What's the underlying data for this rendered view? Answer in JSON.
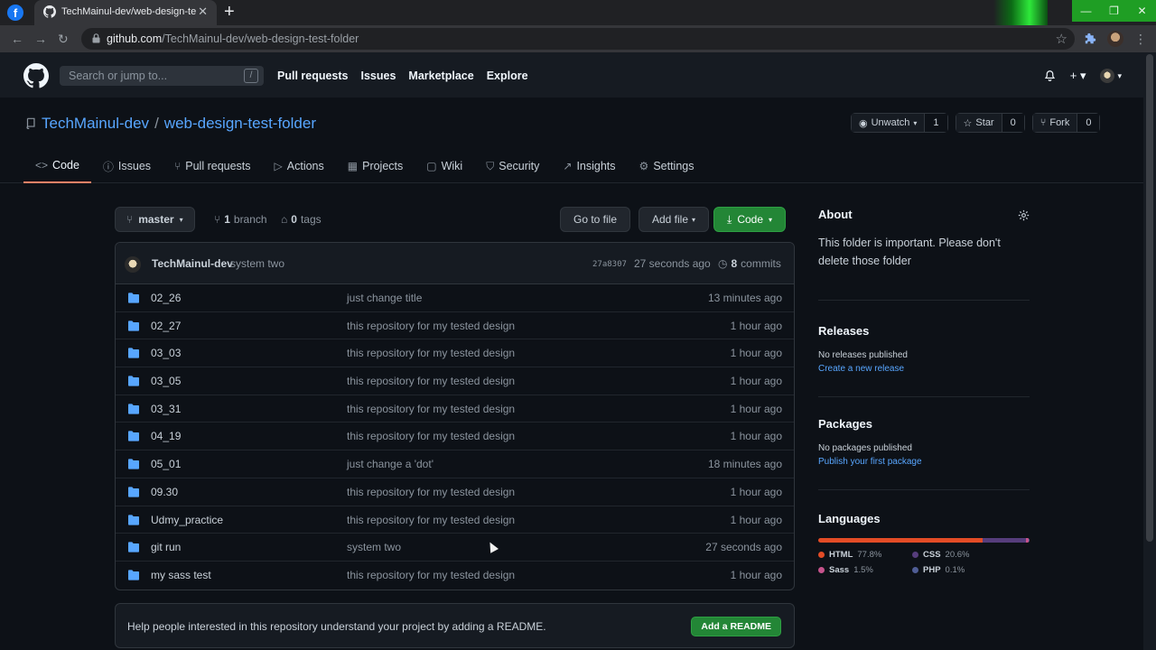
{
  "browser": {
    "tab_title": "TechMainul-dev/web-design-te...",
    "url_host": "github.com",
    "url_path": "/TechMainul-dev/web-design-test-folder",
    "accent_color": "#1f9e24"
  },
  "header": {
    "search_placeholder": "Search or jump to...",
    "search_shortcut": "/",
    "nav": [
      "Pull requests",
      "Issues",
      "Marketplace",
      "Explore"
    ]
  },
  "repo": {
    "owner": "TechMainul-dev",
    "separator": "/",
    "name": "web-design-test-folder",
    "watch_label": "Unwatch",
    "watch_count": "1",
    "star_label": "Star",
    "star_count": "0",
    "fork_label": "Fork",
    "fork_count": "0",
    "tabs": [
      {
        "label": "Code",
        "icon": "code-icon"
      },
      {
        "label": "Issues",
        "icon": "issue-icon"
      },
      {
        "label": "Pull requests",
        "icon": "pull-request-icon"
      },
      {
        "label": "Actions",
        "icon": "play-icon"
      },
      {
        "label": "Projects",
        "icon": "project-icon"
      },
      {
        "label": "Wiki",
        "icon": "book-icon"
      },
      {
        "label": "Security",
        "icon": "shield-icon"
      },
      {
        "label": "Insights",
        "icon": "graph-icon"
      },
      {
        "label": "Settings",
        "icon": "gear-icon"
      }
    ]
  },
  "toolbar": {
    "branch": "master",
    "branch_count": "1",
    "branch_word": "branch",
    "tag_count": "0",
    "tag_word": "tags",
    "goto_file": "Go to file",
    "add_file": "Add file",
    "code": "Code"
  },
  "commit": {
    "author": "TechMainul-dev",
    "message": "system two",
    "sha": "27a8307",
    "ago": "27 seconds ago",
    "count": "8",
    "count_word": "commits"
  },
  "files": [
    {
      "name": "02_26",
      "message": "just change title",
      "age": "13 minutes ago"
    },
    {
      "name": "02_27",
      "message": "this repository for my tested design",
      "age": "1 hour ago"
    },
    {
      "name": "03_03",
      "message": "this repository for my tested design",
      "age": "1 hour ago"
    },
    {
      "name": "03_05",
      "message": "this repository for my tested design",
      "age": "1 hour ago"
    },
    {
      "name": "03_31",
      "message": "this repository for my tested design",
      "age": "1 hour ago"
    },
    {
      "name": "04_19",
      "message": "this repository for my tested design",
      "age": "1 hour ago"
    },
    {
      "name": "05_01",
      "message": "just change a 'dot'",
      "age": "18 minutes ago"
    },
    {
      "name": "09.30",
      "message": "this repository for my tested design",
      "age": "1 hour ago"
    },
    {
      "name": "Udmy_practice",
      "message": "this repository for my tested design",
      "age": "1 hour ago"
    },
    {
      "name": "git run",
      "message": "system two",
      "age": "27 seconds ago"
    },
    {
      "name": "my sass test",
      "message": "this repository for my tested design",
      "age": "1 hour ago"
    }
  ],
  "readme": {
    "text": "Help people interested in this repository understand your project by adding a README.",
    "button": "Add a README"
  },
  "sidebar": {
    "about_title": "About",
    "about_desc": "This folder is important. Please don't delete those folder",
    "releases_title": "Releases",
    "releases_none": "No releases published",
    "releases_link": "Create a new release",
    "packages_title": "Packages",
    "packages_none": "No packages published",
    "packages_link": "Publish your first package",
    "languages_title": "Languages",
    "languages": [
      {
        "name": "HTML",
        "percent": "77.8%",
        "value": 77.8,
        "color": "#e34c26"
      },
      {
        "name": "CSS",
        "percent": "20.6%",
        "value": 20.6,
        "color": "#563d7c"
      },
      {
        "name": "Sass",
        "percent": "1.5%",
        "value": 1.5,
        "color": "#c6538c"
      },
      {
        "name": "PHP",
        "percent": "0.1%",
        "value": 0.1,
        "color": "#4f5d95"
      }
    ]
  }
}
